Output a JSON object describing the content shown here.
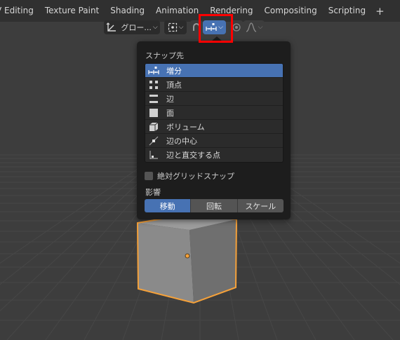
{
  "colors": {
    "accent": "#4772b3",
    "highlight": "#ff0000",
    "selection_outline": "#f5a13a"
  },
  "workspace_tabs": [
    "V Editing",
    "Texture Paint",
    "Shading",
    "Animation",
    "Rendering",
    "Compositing",
    "Scripting"
  ],
  "workspace_add": "+",
  "header": {
    "orientation_label": "グロー...",
    "snap_toggle_active": true
  },
  "snap_popover": {
    "heading": "スナップ先",
    "items": [
      {
        "label": "増分",
        "icon": "increment-icon",
        "selected": true
      },
      {
        "label": "頂点",
        "icon": "vertex-icon",
        "selected": false
      },
      {
        "label": "辺",
        "icon": "edge-icon",
        "selected": false
      },
      {
        "label": "面",
        "icon": "face-icon",
        "selected": false
      },
      {
        "label": "ボリューム",
        "icon": "volume-icon",
        "selected": false
      },
      {
        "label": "辺の中心",
        "icon": "edge-center-icon",
        "selected": false
      },
      {
        "label": "辺と直交する点",
        "icon": "edge-perpendicular-icon",
        "selected": false
      }
    ],
    "absolute_grid_snap": {
      "label": "絶対グリッドスナップ",
      "checked": false
    },
    "affect_label": "影響",
    "affect_buttons": [
      {
        "label": "移動",
        "active": true
      },
      {
        "label": "回転",
        "active": false
      },
      {
        "label": "スケール",
        "active": false
      }
    ]
  }
}
